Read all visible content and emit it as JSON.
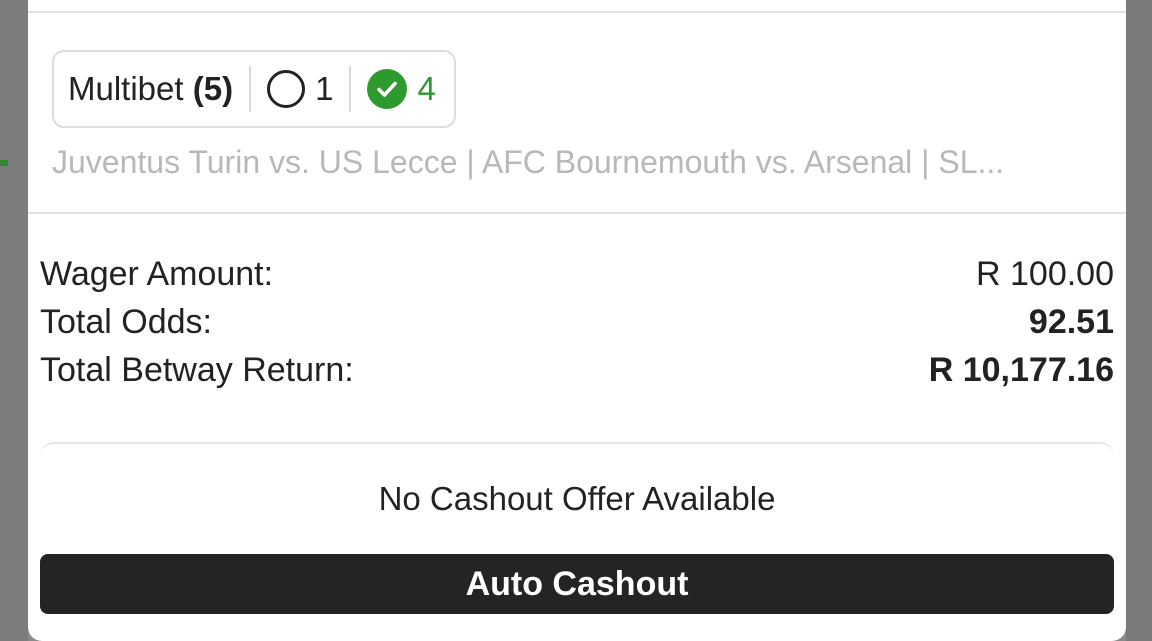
{
  "bet": {
    "type_label": "Multibet",
    "leg_count": "(5)",
    "open_legs": "1",
    "won_legs": "4",
    "matches": "Juventus Turin vs. US Lecce | AFC Bournemouth vs. Arsenal | SL..."
  },
  "summary": {
    "wager_label": "Wager Amount:",
    "wager_value": "R 100.00",
    "odds_label": "Total Odds:",
    "odds_value": "92.51",
    "return_label": "Total Betway Return:",
    "return_value": "R 10,177.16"
  },
  "cashout": {
    "message": "No Cashout Offer Available",
    "auto_cashout_label": "Auto Cashout"
  },
  "colors": {
    "accent_green": "#2e9a2e",
    "button_dark": "#242424",
    "muted_text": "#b8b8b8"
  },
  "icons": {
    "open_leg": "open-circle-icon",
    "won_leg": "check-circle-icon"
  }
}
